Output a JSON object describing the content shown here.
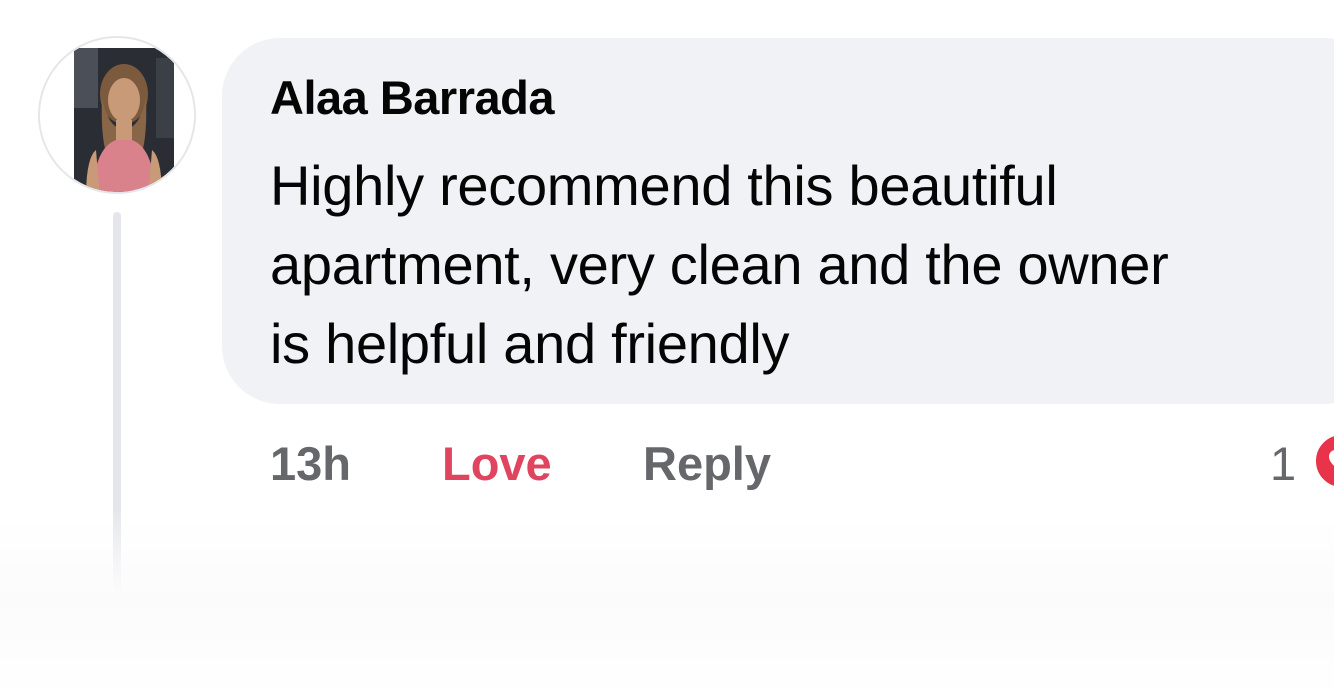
{
  "comment": {
    "author": "Alaa Barrada",
    "text_lines": [
      "Highly recommend this beautiful",
      "apartment, very clean and the owner",
      "is helpful and friendly"
    ],
    "avatar_icon": "profile-photo"
  },
  "actions": {
    "time": "13h",
    "love_label": "Love",
    "reply_label": "Reply",
    "reaction_count": "1",
    "reaction_icon": "love-reaction-icon"
  },
  "colors": {
    "bubble": "#f0f2f5",
    "love": "#e0455f",
    "muted": "#65676b",
    "text": "#050505"
  }
}
